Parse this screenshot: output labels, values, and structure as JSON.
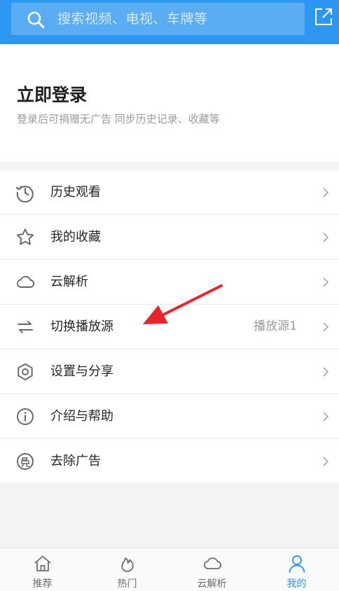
{
  "header": {
    "search_placeholder": "搜索视频、电视、车牌等",
    "search_icon": "search-icon",
    "share_icon": "share-icon"
  },
  "login": {
    "title": "立即登录",
    "subtitle": "登录后可捐赠无广告 同步历史记录、收藏等"
  },
  "menu": {
    "items": [
      {
        "label": "历史观看",
        "icon": "history-icon"
      },
      {
        "label": "我的收藏",
        "icon": "star-icon"
      },
      {
        "label": "云解析",
        "icon": "cloud-icon"
      },
      {
        "label": "切换播放源",
        "icon": "switch-icon",
        "value": "播放源1"
      },
      {
        "label": "设置与分享",
        "icon": "gear-icon"
      },
      {
        "label": "介绍与帮助",
        "icon": "info-icon"
      },
      {
        "label": "去除广告",
        "icon": "ad-free-icon"
      }
    ]
  },
  "tabs": [
    {
      "label": "推荐",
      "icon": "home-icon"
    },
    {
      "label": "热门",
      "icon": "fire-icon"
    },
    {
      "label": "云解析",
      "icon": "cloud-icon"
    },
    {
      "label": "我的",
      "icon": "user-icon",
      "active": true
    }
  ],
  "colors": {
    "accent": "#2c96f0",
    "arrow": "#e8262a"
  }
}
